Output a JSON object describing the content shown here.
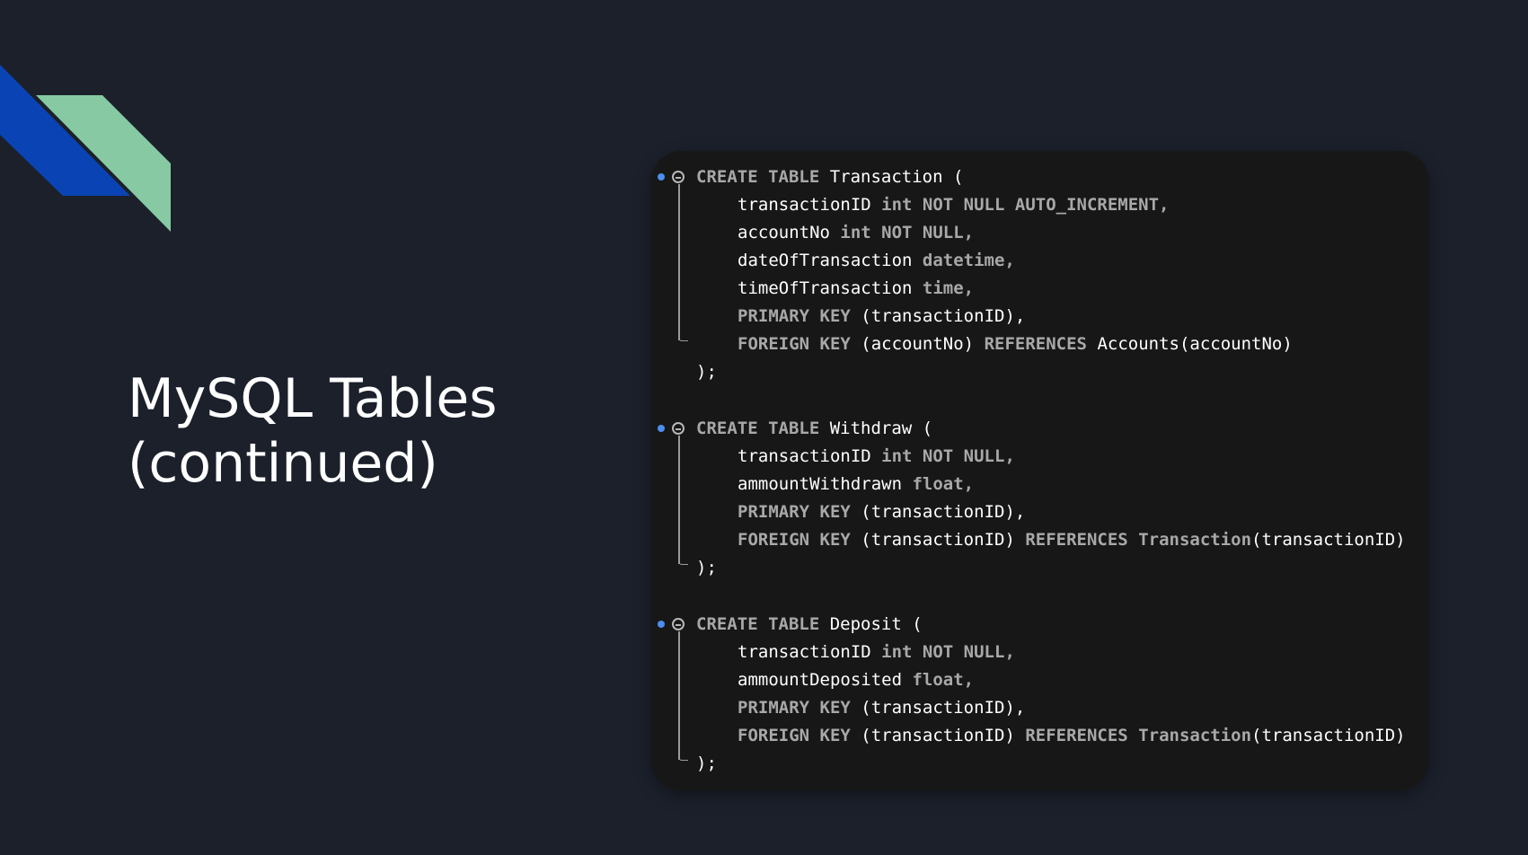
{
  "slide": {
    "title_line1": "MySQL Tables",
    "title_line2": "(continued)"
  },
  "colors": {
    "background": "#1b202b",
    "panel": "#171717",
    "accent_blue": "#0a44b4",
    "accent_green": "#86c9a2",
    "keyword": "#a8a8a8",
    "identifier": "#ffffff",
    "breakpoint": "#4a8ff0"
  },
  "code": {
    "transaction": {
      "l1a": "CREATE TABLE",
      "l1b": "Transaction (",
      "l2a": "transactionID",
      "l2b": "int NOT NULL AUTO_INCREMENT,",
      "l3a": "accountNo",
      "l3b": "int NOT NULL,",
      "l4a": "dateOfTransaction",
      "l4b": "datetime,",
      "l5a": "timeOfTransaction",
      "l5b": "time,",
      "l6a": "PRIMARY KEY",
      "l6b": "(transactionID),",
      "l7a": "FOREIGN KEY",
      "l7b": "(accountNo)",
      "l7c": "REFERENCES",
      "l7d": "Accounts(accountNo)",
      "l8": ");"
    },
    "withdraw": {
      "l1a": "CREATE TABLE",
      "l1b": "Withdraw (",
      "l2a": "transactionID",
      "l2b": "int NOT NULL,",
      "l3a": "ammountWithdrawn",
      "l3b": "float,",
      "l4a": "PRIMARY KEY",
      "l4b": "(transactionID),",
      "l5a": "FOREIGN KEY",
      "l5b": "(transactionID)",
      "l5c": "REFERENCES",
      "l5d": "Transaction",
      "l5e": "(transactionID)",
      "l6": ");"
    },
    "deposit": {
      "l1a": "CREATE TABLE",
      "l1b": "Deposit (",
      "l2a": "transactionID",
      "l2b": "int NOT NULL,",
      "l3a": "ammountDeposited",
      "l3b": "float,",
      "l4a": "PRIMARY KEY",
      "l4b": "(transactionID),",
      "l5a": "FOREIGN KEY",
      "l5b": "(transactionID)",
      "l5c": "REFERENCES",
      "l5d": "Transaction",
      "l5e": "(transactionID)",
      "l6": ");"
    }
  },
  "icons": [
    "breakpoint-dot",
    "fold-collapse-icon",
    "fold-guide"
  ]
}
